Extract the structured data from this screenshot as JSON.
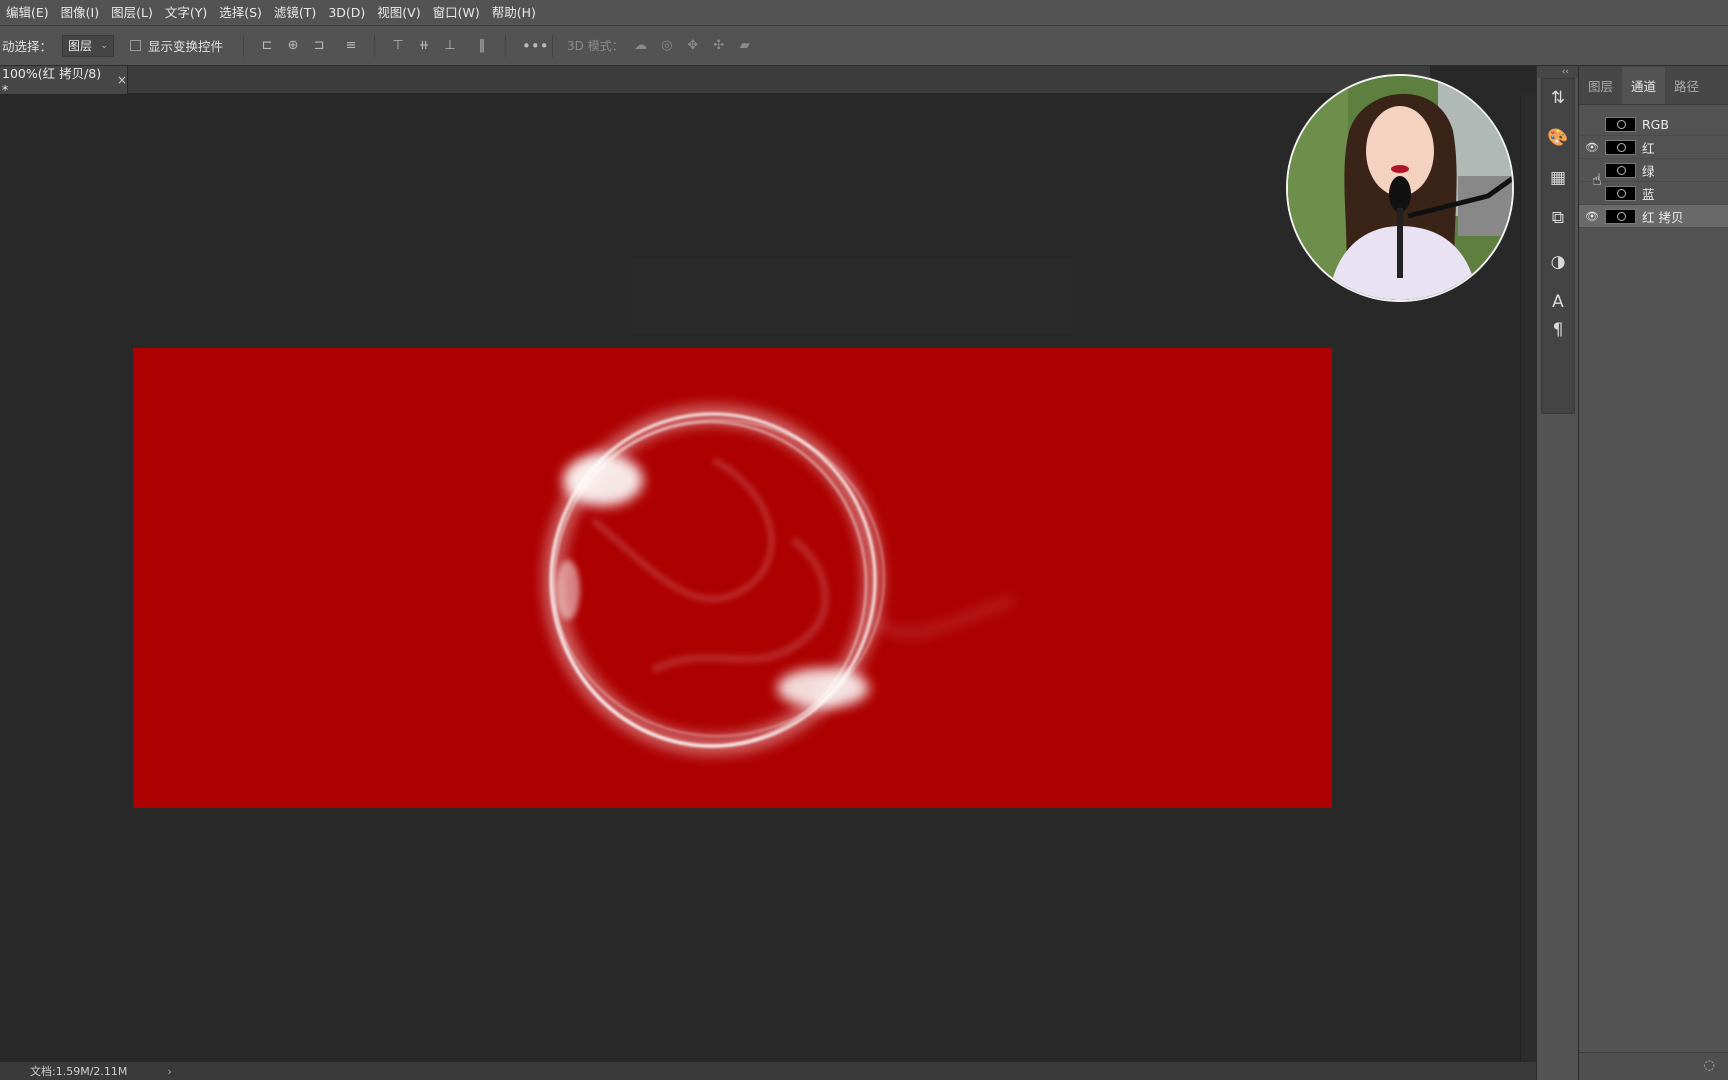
{
  "menubar": {
    "items": [
      "编辑(E)",
      "图像(I)",
      "图层(L)",
      "文字(Y)",
      "选择(S)",
      "滤镜(T)",
      "3D(D)",
      "视图(V)",
      "窗口(W)",
      "帮助(H)"
    ]
  },
  "options": {
    "auto_select_label": "动选择：",
    "auto_select_value": "图层",
    "show_transform_label": "显示变换控件",
    "mode_3d_label": "3D 模式："
  },
  "document": {
    "tab_title": "100%(红 拷贝/8) *",
    "tab_close": "×"
  },
  "status": {
    "doc_size": "文档:1.59M/2.11M",
    "arrow": "›"
  },
  "panel": {
    "collapse": "‹‹",
    "tabs": [
      "图层",
      "通道",
      "路径"
    ],
    "active_tab": "通道",
    "channels": [
      {
        "name": "RGB",
        "visible": false,
        "selected": false
      },
      {
        "name": "红",
        "visible": true,
        "selected": false
      },
      {
        "name": "绿",
        "visible": false,
        "selected": false
      },
      {
        "name": "蓝",
        "visible": false,
        "selected": false
      },
      {
        "name": "红 拷贝",
        "visible": true,
        "selected": true
      }
    ]
  },
  "colors": {
    "canvas_fill": "#ad0000",
    "workspace": "#282828",
    "chrome": "#535353"
  }
}
